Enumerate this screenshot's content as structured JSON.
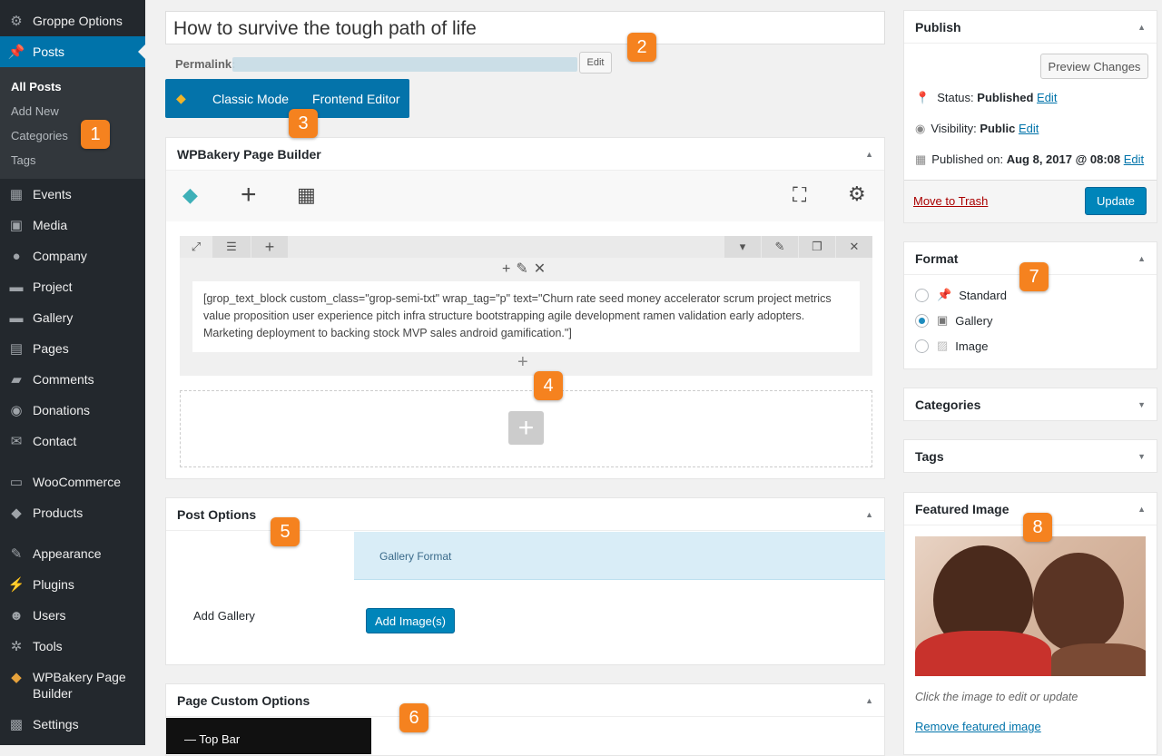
{
  "sidebar": {
    "items": [
      {
        "label": "Groppe Options",
        "icon": "groppe-icon"
      },
      {
        "label": "Posts",
        "icon": "pushpin-icon"
      },
      {
        "label": "Events",
        "icon": "calendar-icon"
      },
      {
        "label": "Media",
        "icon": "media-icon"
      },
      {
        "label": "Company",
        "icon": "people-icon"
      },
      {
        "label": "Project",
        "icon": "folder-icon"
      },
      {
        "label": "Gallery",
        "icon": "folder-icon"
      },
      {
        "label": "Pages",
        "icon": "pages-icon"
      },
      {
        "label": "Comments",
        "icon": "comment-icon"
      },
      {
        "label": "Donations",
        "icon": "donation-icon"
      },
      {
        "label": "Contact",
        "icon": "envelope-icon"
      },
      {
        "label": "WooCommerce",
        "icon": "woo-icon"
      },
      {
        "label": "Products",
        "icon": "box-icon"
      },
      {
        "label": "Appearance",
        "icon": "brush-icon"
      },
      {
        "label": "Plugins",
        "icon": "plug-icon"
      },
      {
        "label": "Users",
        "icon": "user-icon"
      },
      {
        "label": "Tools",
        "icon": "wrench-icon"
      },
      {
        "label": "WPBakery Page Builder",
        "icon": "wpbakery-icon"
      },
      {
        "label": "Settings",
        "icon": "settings-icon"
      }
    ],
    "submenu": [
      "All Posts",
      "Add New",
      "Categories",
      "Tags"
    ]
  },
  "title": "How to survive the tough path of life",
  "permalink": {
    "label": "Permalink:",
    "edit": "Edit"
  },
  "mode_bar": {
    "classic": "Classic Mode",
    "frontend": "Frontend Editor"
  },
  "builder": {
    "title": "WPBakery Page Builder",
    "shortcode": "[grop_text_block custom_class=\"grop-semi-txt\" wrap_tag=\"p\" text=\"Churn rate seed money accelerator scrum project metrics value proposition user experience pitch infra structure bootstrapping agile development ramen validation early adopters. Marketing deployment to backing stock MVP sales android gamification.\"]"
  },
  "post_options": {
    "title": "Post Options",
    "tab": "Gallery Format",
    "add_gallery_label": "Add Gallery",
    "add_images": "Add Image(s)"
  },
  "page_custom": {
    "title": "Page Custom Options",
    "tab": "Top Bar"
  },
  "publish": {
    "title": "Publish",
    "preview": "Preview Changes",
    "status_label": "Status:",
    "status_value": "Published",
    "visibility_label": "Visibility:",
    "visibility_value": "Public",
    "published_label": "Published on:",
    "published_value": "Aug 8, 2017 @ 08:08",
    "edit": "Edit",
    "trash": "Move to Trash",
    "update": "Update"
  },
  "format": {
    "title": "Format",
    "options": [
      "Standard",
      "Gallery",
      "Image"
    ],
    "selected": "Gallery"
  },
  "categories": {
    "title": "Categories"
  },
  "tags": {
    "title": "Tags"
  },
  "featured": {
    "title": "Featured Image",
    "hint": "Click the image to edit or update",
    "remove": "Remove featured image"
  },
  "badges": [
    "1",
    "2",
    "3",
    "4",
    "5",
    "6",
    "7",
    "8"
  ],
  "colors": {
    "accent": "#0073aa",
    "sidebar": "#23282d",
    "badge": "#f5821f",
    "primary": "#0085ba"
  }
}
